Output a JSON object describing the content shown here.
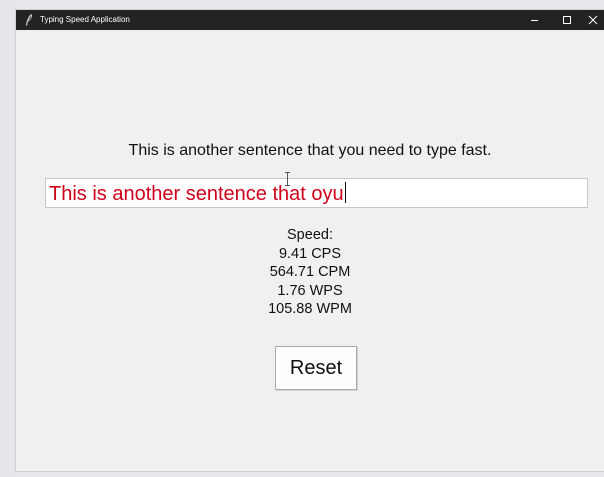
{
  "window": {
    "title": "Typing Speed Application",
    "icon": "feather-icon",
    "controls": [
      "minimize-icon",
      "maximize-icon",
      "close-icon"
    ]
  },
  "prompt": {
    "sentence": "This is another sentence that you need to type fast."
  },
  "input": {
    "value": "This is another sentence that oyu",
    "text_color": "#d0021b"
  },
  "stats": {
    "heading": "Speed:",
    "cps": "9.41 CPS",
    "cpm": "564.71 CPM",
    "wps": "1.76 WPS",
    "wpm": "105.88 WPM"
  },
  "reset_button": {
    "label": "Reset"
  },
  "colors": {
    "titlebar": "#232323",
    "window_bg": "#f0f0f0",
    "error_text": "#d0021b"
  }
}
